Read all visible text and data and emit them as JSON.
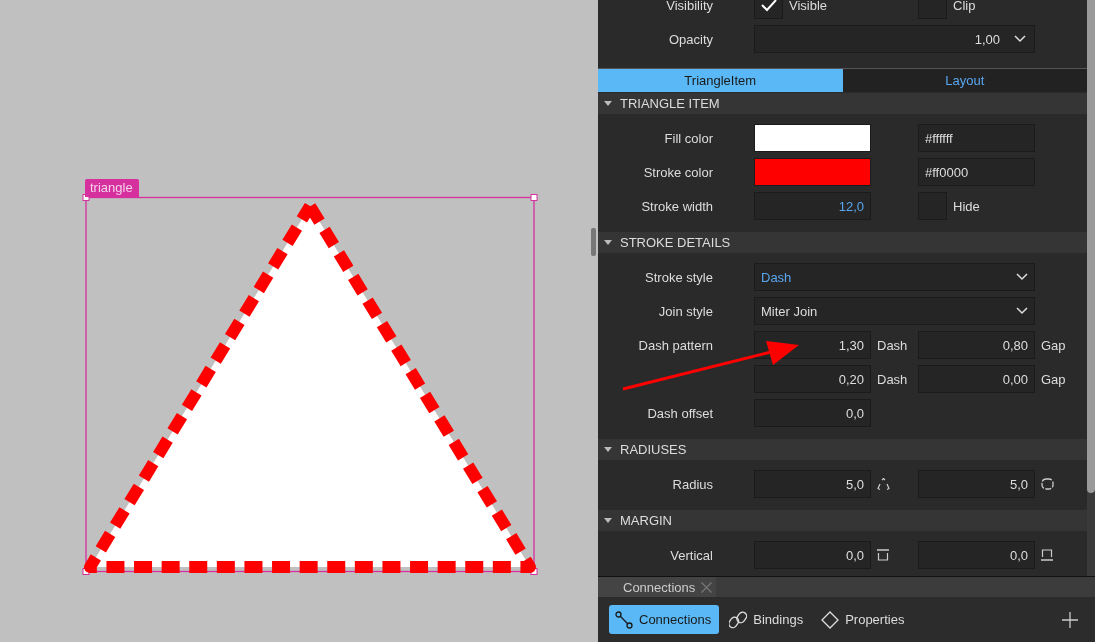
{
  "canvas": {
    "item_label": "triangle"
  },
  "properties": {
    "visibility": {
      "label": "Visibility",
      "options": [
        {
          "label": "Visible",
          "checked": true
        },
        {
          "label": "Clip",
          "checked": false
        }
      ]
    },
    "opacity": {
      "label": "Opacity",
      "value": "1,00"
    },
    "tabs": [
      {
        "label": "TriangleItem",
        "selected": true
      },
      {
        "label": "Layout",
        "selected": false
      }
    ],
    "sections": [
      {
        "title": "TRIANGLE ITEM",
        "expanded": true,
        "rows": [
          {
            "kind": "color",
            "label": "Fill color",
            "color": "#ffffff",
            "value": "#ffffff"
          },
          {
            "kind": "color",
            "label": "Stroke color",
            "color": "#ff0000",
            "value": "#ff0000"
          },
          {
            "kind": "number_toggle",
            "label": "Stroke width",
            "value": "12,0",
            "modified": true,
            "toggle": {
              "label": "Hide",
              "checked": false
            }
          }
        ]
      },
      {
        "title": "STROKE DETAILS",
        "expanded": true,
        "rows": [
          {
            "kind": "dropdown",
            "label": "Stroke style",
            "value": "Dash",
            "modified": true
          },
          {
            "kind": "dropdown",
            "label": "Join style",
            "value": "Miter Join",
            "modified": false
          },
          {
            "kind": "pair",
            "label": "Dash pattern",
            "fields": [
              {
                "value": "1,30",
                "suffix": "Dash"
              },
              {
                "value": "0,80",
                "suffix": "Gap"
              }
            ]
          },
          {
            "kind": "pair",
            "fields": [
              {
                "value": "0,20",
                "suffix": "Dash"
              },
              {
                "value": "0,00",
                "suffix": "Gap"
              }
            ]
          },
          {
            "kind": "single",
            "label": "Dash offset",
            "value": "0,0"
          }
        ]
      },
      {
        "title": "RADIUSES",
        "expanded": true,
        "rows": [
          {
            "kind": "radius",
            "label": "Radius",
            "fields": [
              {
                "value": "5,0"
              },
              {
                "value": "5,0"
              }
            ]
          }
        ]
      },
      {
        "title": "MARGIN",
        "expanded": true,
        "rows": [
          {
            "kind": "margin",
            "label": "Vertical",
            "fields": [
              {
                "value": "0,0"
              },
              {
                "value": "0,0"
              }
            ]
          }
        ]
      }
    ]
  },
  "dock": {
    "tab": {
      "label": "Connections"
    },
    "buttons": [
      {
        "kind": "connections",
        "label": "Connections",
        "selected": true
      },
      {
        "kind": "bindings",
        "label": "Bindings",
        "selected": false
      },
      {
        "kind": "properties",
        "label": "Properties",
        "selected": false
      }
    ]
  }
}
